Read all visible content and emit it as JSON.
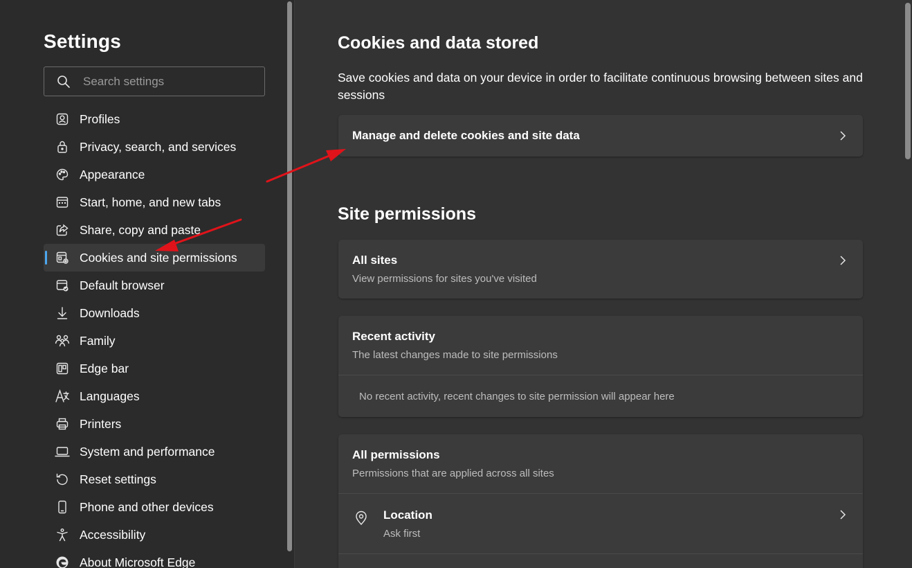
{
  "sidebar": {
    "title": "Settings",
    "search": {
      "placeholder": "Search settings",
      "value": ""
    },
    "items": [
      {
        "label": "Profiles",
        "icon": "profile-icon"
      },
      {
        "label": "Privacy, search, and services",
        "icon": "lock-icon"
      },
      {
        "label": "Appearance",
        "icon": "palette-icon"
      },
      {
        "label": "Start, home, and new tabs",
        "icon": "home-tabs-icon"
      },
      {
        "label": "Share, copy and paste",
        "icon": "share-icon"
      },
      {
        "label": "Cookies and site permissions",
        "icon": "cookies-permissions-icon",
        "active": true
      },
      {
        "label": "Default browser",
        "icon": "default-browser-icon"
      },
      {
        "label": "Downloads",
        "icon": "download-icon"
      },
      {
        "label": "Family",
        "icon": "family-icon"
      },
      {
        "label": "Edge bar",
        "icon": "edge-bar-icon"
      },
      {
        "label": "Languages",
        "icon": "languages-icon"
      },
      {
        "label": "Printers",
        "icon": "printer-icon"
      },
      {
        "label": "System and performance",
        "icon": "laptop-icon"
      },
      {
        "label": "Reset settings",
        "icon": "reset-icon"
      },
      {
        "label": "Phone and other devices",
        "icon": "phone-icon"
      },
      {
        "label": "Accessibility",
        "icon": "accessibility-icon"
      },
      {
        "label": "About Microsoft Edge",
        "icon": "edge-logo-icon"
      }
    ]
  },
  "main": {
    "cookies": {
      "heading": "Cookies and data stored",
      "description": "Save cookies and data on your device in order to facilitate continuous browsing between sites and sessions",
      "manage_label": "Manage and delete cookies and site data"
    },
    "permissions": {
      "heading": "Site permissions",
      "all_sites": {
        "title": "All sites",
        "subtitle": "View permissions for sites you've visited"
      },
      "recent": {
        "title": "Recent activity",
        "subtitle": "The latest changes made to site permissions",
        "empty": "No recent activity, recent changes to site permission will appear here"
      },
      "all_permissions": {
        "title": "All permissions",
        "subtitle": "Permissions that are applied across all sites",
        "location": {
          "title": "Location",
          "subtitle": "Ask first",
          "icon": "location-icon"
        }
      }
    }
  },
  "colors": {
    "sidebar_bg": "#2b2b2b",
    "main_bg": "#333333",
    "card_bg": "#3b3b3b",
    "accent": "#4ca7ef",
    "annotation_arrow": "#e0131a"
  }
}
